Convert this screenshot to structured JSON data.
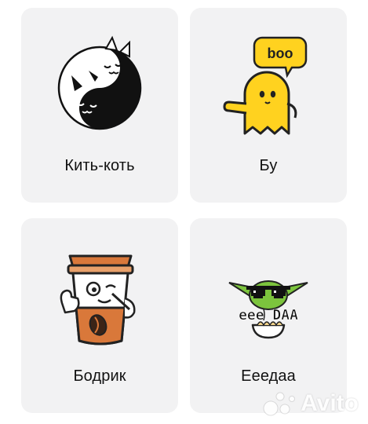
{
  "stickers": [
    {
      "title": "Кить-коть",
      "art": "yin-yang-cats-icon"
    },
    {
      "title": "Бу",
      "art": "boo-ghost-icon",
      "speech_bubble": "boo"
    },
    {
      "title": "Бодрик",
      "art": "coffee-cup-mascot-icon"
    },
    {
      "title": "Ееедаа",
      "art": "baby-yoda-eating-icon",
      "caption": "eee DAA"
    }
  ],
  "watermark": {
    "text": "Avito",
    "icon": "avito-dots-icon"
  },
  "colors": {
    "card_bg": "#f2f2f3",
    "ghost_yellow": "#ffd21f",
    "coffee_orange": "#d9783a",
    "yoda_green": "#7cc43d"
  }
}
